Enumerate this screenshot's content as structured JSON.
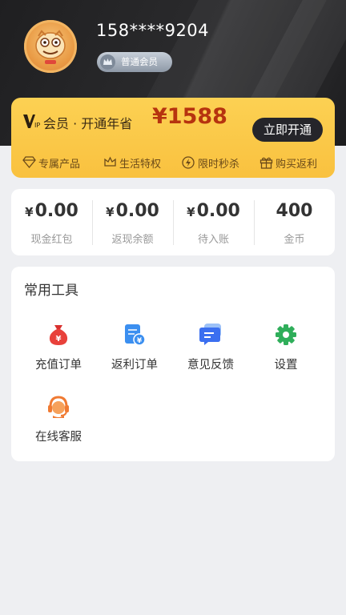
{
  "profile": {
    "phone": "158****9204",
    "level_label": "普通会员"
  },
  "vip": {
    "title": "会员 · 开通年省",
    "price": "¥1588",
    "open_button": "立即开通",
    "perks": [
      "专属产品",
      "生活特权",
      "限时秒杀",
      "购买返利"
    ]
  },
  "stats": [
    {
      "currency": "¥",
      "value": "0.00",
      "label": "现金红包"
    },
    {
      "currency": "¥",
      "value": "0.00",
      "label": "返现余额"
    },
    {
      "currency": "¥",
      "value": "0.00",
      "label": "待入账"
    },
    {
      "currency": "",
      "value": "400",
      "label": "金币"
    }
  ],
  "tools": {
    "title": "常用工具",
    "items": [
      {
        "label": "充值订单",
        "icon": "money-bag-icon"
      },
      {
        "label": "返利订单",
        "icon": "rebate-order-icon"
      },
      {
        "label": "意见反馈",
        "icon": "feedback-icon"
      },
      {
        "label": "设置",
        "icon": "gear-icon"
      },
      {
        "label": "在线客服",
        "icon": "customer-service-icon"
      }
    ]
  },
  "colors": {
    "header_bg": "#1f1f21",
    "vip_gold": "#fbc84a",
    "price_red": "#b6330f",
    "page_bg": "#eeeff2"
  }
}
